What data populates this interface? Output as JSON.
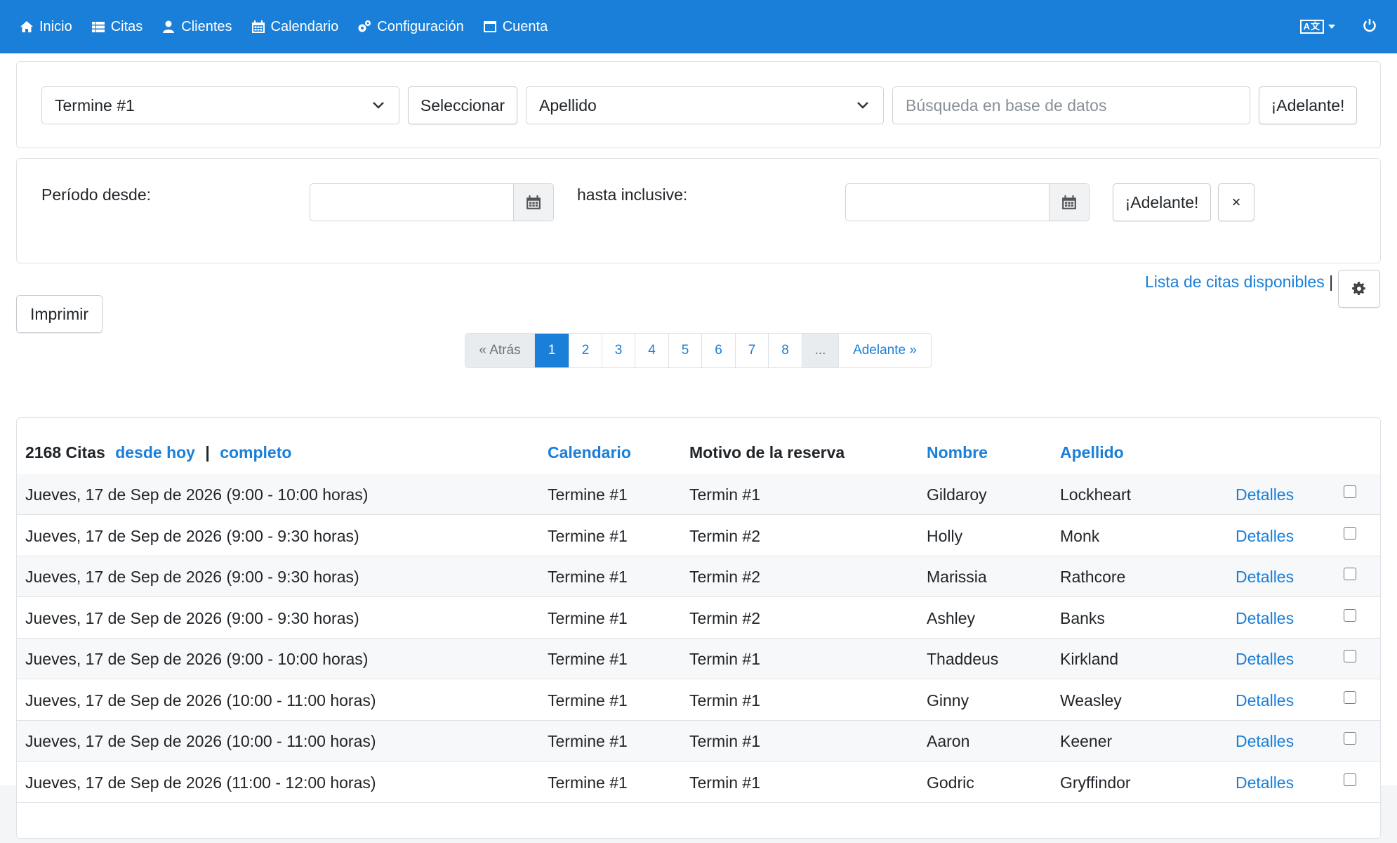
{
  "nav": {
    "items": [
      {
        "label": "Inicio",
        "icon": "home-icon"
      },
      {
        "label": "Citas",
        "icon": "list-icon"
      },
      {
        "label": "Clientes",
        "icon": "user-icon"
      },
      {
        "label": "Calendario",
        "icon": "calendar-icon"
      },
      {
        "label": "Configuración",
        "icon": "gears-icon"
      },
      {
        "label": "Cuenta",
        "icon": "window-icon"
      }
    ],
    "language_badge": "A文"
  },
  "filter": {
    "calendar_select": "Termine #1",
    "select_button": "Seleccionar",
    "field_select": "Apellido",
    "search_placeholder": "Búsqueda en base de datos",
    "search_button": "¡Adelante!"
  },
  "period": {
    "from_label": "Período desde:",
    "to_label": "hasta inclusive:",
    "from_value": "",
    "to_value": "",
    "go_button": "¡Adelante!",
    "clear_button": "×"
  },
  "actions": {
    "available_link": "Lista de citas disponibles",
    "separator": "|",
    "print_button": "Imprimir"
  },
  "pagination": {
    "prev": "« Atrás",
    "pages": [
      "1",
      "2",
      "3",
      "4",
      "5",
      "6",
      "7",
      "8"
    ],
    "ellipsis": "...",
    "next": "Adelante »",
    "active": "1"
  },
  "table": {
    "count": "2168 Citas",
    "from_today": "desde hoy",
    "separator": "|",
    "complete": "completo",
    "headers": {
      "calendar": "Calendario",
      "reason": "Motivo de la reserva",
      "first_name": "Nombre",
      "last_name": "Apellido"
    },
    "details_label": "Detalles",
    "rows": [
      {
        "date": "Jueves, 17 de Sep de 2026 (9:00 - 10:00 horas)",
        "calendar": "Termine #1",
        "reason": "Termin #1",
        "first": "Gildaroy",
        "last": "Lockheart"
      },
      {
        "date": "Jueves, 17 de Sep de 2026 (9:00 - 9:30 horas)",
        "calendar": "Termine #1",
        "reason": "Termin #2",
        "first": "Holly",
        "last": "Monk"
      },
      {
        "date": "Jueves, 17 de Sep de 2026 (9:00 - 9:30 horas)",
        "calendar": "Termine #1",
        "reason": "Termin #2",
        "first": "Marissia",
        "last": "Rathcore"
      },
      {
        "date": "Jueves, 17 de Sep de 2026 (9:00 - 9:30 horas)",
        "calendar": "Termine #1",
        "reason": "Termin #2",
        "first": "Ashley",
        "last": "Banks"
      },
      {
        "date": "Jueves, 17 de Sep de 2026 (9:00 - 10:00 horas)",
        "calendar": "Termine #1",
        "reason": "Termin #1",
        "first": "Thaddeus",
        "last": "Kirkland"
      },
      {
        "date": "Jueves, 17 de Sep de 2026 (10:00 - 11:00 horas)",
        "calendar": "Termine #1",
        "reason": "Termin #1",
        "first": "Ginny",
        "last": "Weasley"
      },
      {
        "date": "Jueves, 17 de Sep de 2026 (10:00 - 11:00 horas)",
        "calendar": "Termine #1",
        "reason": "Termin #1",
        "first": "Aaron",
        "last": "Keener"
      },
      {
        "date": "Jueves, 17 de Sep de 2026 (11:00 - 12:00 horas)",
        "calendar": "Termine #1",
        "reason": "Termin #1",
        "first": "Godric",
        "last": "Gryffindor"
      }
    ]
  },
  "colors": {
    "accent": "#1a7fd8",
    "background": "#f4f5f7"
  }
}
